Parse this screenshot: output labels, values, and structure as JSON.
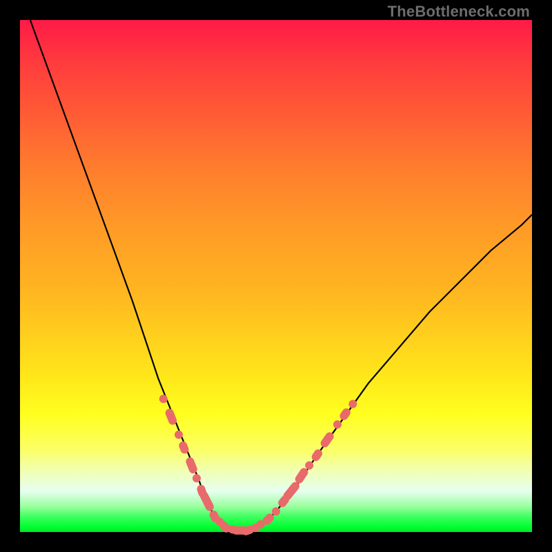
{
  "attribution": "TheBottleneck.com",
  "colors": {
    "frame_bg": "#000000",
    "curve_stroke": "#000000",
    "marker_fill": "#e86a6a",
    "gradient_top": "#ff1a47",
    "gradient_bottom": "#00e929"
  },
  "chart_data": {
    "type": "line",
    "title": "",
    "xlabel": "",
    "ylabel": "",
    "xlim": [
      0,
      100
    ],
    "ylim": [
      0,
      100
    ],
    "grid": false,
    "legend": false,
    "series": [
      {
        "name": "bottleneck-curve",
        "x": [
          2,
          6,
          10,
          14,
          18,
          22,
          25,
          27,
          29,
          31,
          33,
          35,
          36,
          37,
          38,
          39,
          40,
          42,
          44,
          47,
          50,
          54,
          58,
          63,
          68,
          74,
          80,
          86,
          92,
          98,
          100
        ],
        "y": [
          100,
          89,
          78,
          67,
          56,
          45,
          36,
          30,
          25,
          20,
          15,
          10,
          7,
          5,
          3,
          2,
          1,
          0,
          0,
          1,
          4,
          9,
          15,
          22,
          29,
          36,
          43,
          49,
          55,
          60,
          62
        ]
      }
    ],
    "markers": [
      {
        "x": 28,
        "y": 26,
        "size": 1
      },
      {
        "x": 29.5,
        "y": 22.5,
        "size": 2
      },
      {
        "x": 31,
        "y": 19,
        "size": 1
      },
      {
        "x": 32,
        "y": 16.5,
        "size": 1.5
      },
      {
        "x": 33.5,
        "y": 13,
        "size": 2
      },
      {
        "x": 34.5,
        "y": 10.5,
        "size": 1
      },
      {
        "x": 35.5,
        "y": 8,
        "size": 1.5
      },
      {
        "x": 36.5,
        "y": 6,
        "size": 2.5
      },
      {
        "x": 38,
        "y": 3,
        "size": 1.5
      },
      {
        "x": 39,
        "y": 2,
        "size": 1
      },
      {
        "x": 40,
        "y": 1,
        "size": 1.5
      },
      {
        "x": 41.5,
        "y": 0.5,
        "size": 1
      },
      {
        "x": 43,
        "y": 0.3,
        "size": 2
      },
      {
        "x": 44.5,
        "y": 0.3,
        "size": 1.5
      },
      {
        "x": 46,
        "y": 0.8,
        "size": 1
      },
      {
        "x": 47,
        "y": 1.5,
        "size": 1
      },
      {
        "x": 48.5,
        "y": 2.5,
        "size": 1.5
      },
      {
        "x": 50,
        "y": 4,
        "size": 1
      },
      {
        "x": 51.5,
        "y": 6,
        "size": 1.5
      },
      {
        "x": 53,
        "y": 8,
        "size": 2.5
      },
      {
        "x": 55,
        "y": 11,
        "size": 2
      },
      {
        "x": 56.5,
        "y": 13,
        "size": 1
      },
      {
        "x": 58,
        "y": 15,
        "size": 1.5
      },
      {
        "x": 60,
        "y": 18,
        "size": 2
      },
      {
        "x": 62,
        "y": 21,
        "size": 1
      },
      {
        "x": 63.5,
        "y": 23,
        "size": 1.5
      },
      {
        "x": 65,
        "y": 25,
        "size": 1
      }
    ]
  }
}
